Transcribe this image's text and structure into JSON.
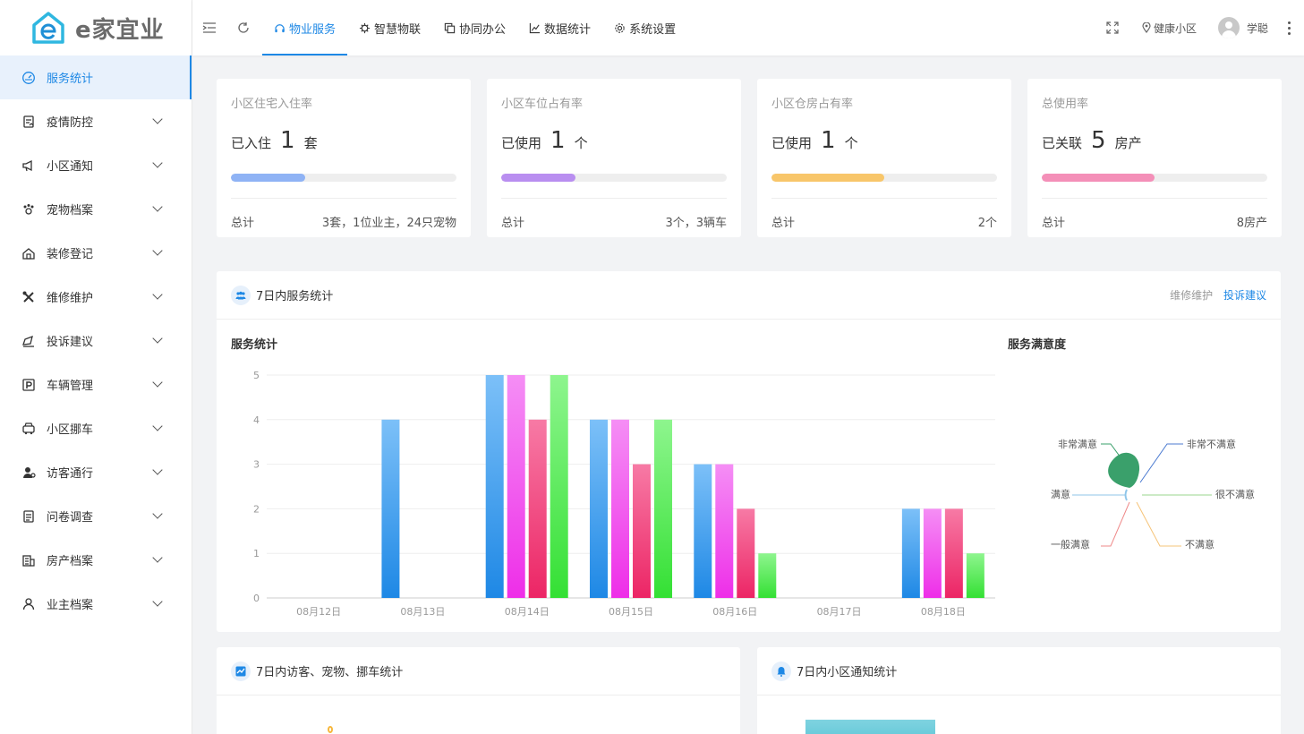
{
  "brand": {
    "name": "e家宜业"
  },
  "sidebar": {
    "items": [
      {
        "label": "服务统计",
        "icon": "dashboard-icon",
        "active": true
      },
      {
        "label": "疫情防控",
        "icon": "clipboard-icon"
      },
      {
        "label": "小区通知",
        "icon": "megaphone-icon"
      },
      {
        "label": "宠物档案",
        "icon": "paw-icon"
      },
      {
        "label": "装修登记",
        "icon": "house-icon"
      },
      {
        "label": "维修维护",
        "icon": "tools-icon"
      },
      {
        "label": "投诉建议",
        "icon": "feedback-icon"
      },
      {
        "label": "车辆管理",
        "icon": "parking-icon"
      },
      {
        "label": "小区挪车",
        "icon": "car-icon"
      },
      {
        "label": "访客通行",
        "icon": "visitor-icon"
      },
      {
        "label": "问卷调查",
        "icon": "survey-icon"
      },
      {
        "label": "房产档案",
        "icon": "building-icon"
      },
      {
        "label": "业主档案",
        "icon": "user-icon"
      }
    ]
  },
  "header": {
    "tabs": [
      {
        "label": "物业服务",
        "icon": "headset-icon",
        "active": true
      },
      {
        "label": "智慧物联",
        "icon": "chip-icon"
      },
      {
        "label": "协同办公",
        "icon": "copy-icon"
      },
      {
        "label": "数据统计",
        "icon": "line-chart-icon"
      },
      {
        "label": "系统设置",
        "icon": "gear-icon"
      }
    ],
    "community": "健康小区",
    "user": "学聪"
  },
  "stats": [
    {
      "title": "小区住宅入住率",
      "prefix": "已入住",
      "value": "1",
      "unit": "套",
      "progress": 0.33,
      "color": "#8fb3f5",
      "total_label": "总计",
      "total_value": "3套，1位业主，24只宠物"
    },
    {
      "title": "小区车位占有率",
      "prefix": "已使用",
      "value": "1",
      "unit": "个",
      "progress": 0.33,
      "color": "#b98ef0",
      "total_label": "总计",
      "total_value": "3个，3辆车"
    },
    {
      "title": "小区仓房占有率",
      "prefix": "已使用",
      "value": "1",
      "unit": "个",
      "progress": 0.5,
      "color": "#f8c66a",
      "total_label": "总计",
      "total_value": "2个"
    },
    {
      "title": "总使用率",
      "prefix": "已关联",
      "value": "5",
      "unit": "房产",
      "progress": 0.5,
      "color": "#f48fb8",
      "total_label": "总计",
      "total_value": "8房产"
    }
  ],
  "service_section": {
    "title": "7日内服务统计",
    "link1": "维修维护",
    "link2": "投诉建议",
    "bar_title": "服务统计",
    "pie_title": "服务满意度"
  },
  "chart_data": [
    {
      "type": "bar",
      "title": "服务统计",
      "categories": [
        "08月12日",
        "08月13日",
        "08月14日",
        "08月15日",
        "08月16日",
        "08月17日",
        "08月18日"
      ],
      "ylim": [
        0,
        5
      ],
      "yticks": [
        0,
        1,
        2,
        3,
        4,
        5
      ],
      "grid": true,
      "series": [
        {
          "values": [
            0,
            4,
            5,
            4,
            3,
            0,
            2
          ],
          "color_top": "#7cc0f8",
          "color_bottom": "#1e88e5"
        },
        {
          "values": [
            0,
            0,
            5,
            4,
            3,
            0,
            2
          ],
          "color_top": "#f58ef5",
          "color_bottom": "#ee2ee8"
        },
        {
          "values": [
            0,
            0,
            4,
            3,
            2,
            0,
            2
          ],
          "color_top": "#f77aa5",
          "color_bottom": "#ec2565"
        },
        {
          "values": [
            0,
            0,
            5,
            4,
            1,
            0,
            1
          ],
          "color_top": "#8ef58e",
          "color_bottom": "#34e034"
        }
      ]
    },
    {
      "type": "pie",
      "title": "服务满意度",
      "categories": [
        "非常满意",
        "非常不满意",
        "满意",
        "很不满意",
        "一般满意",
        "不满意"
      ],
      "values": [
        1,
        0,
        0,
        0,
        0,
        0
      ],
      "colors": [
        "#3aa06b",
        "#4c7bd1",
        "#8fc6ea",
        "#9ad68c",
        "#ef8a8a",
        "#f6c47a"
      ]
    }
  ],
  "bottom_left": {
    "title": "7日内访客、宠物、挪车统计"
  },
  "bottom_right": {
    "title": "7日内小区通知统计"
  }
}
